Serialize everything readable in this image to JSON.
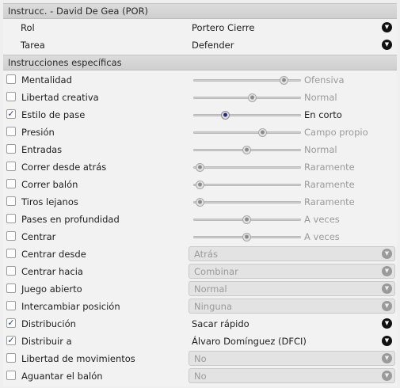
{
  "title": "Instrucc. - David De Gea (POR)",
  "role": {
    "label": "Rol",
    "value": "Portero Cierre"
  },
  "duty": {
    "label": "Tarea",
    "value": "Defender"
  },
  "specific_title": "Instrucciones específicas",
  "instructions": [
    {
      "label": "Mentalidad",
      "checked": false,
      "type": "slider",
      "level": 0.85,
      "value": "Ofensiva"
    },
    {
      "label": "Libertad creativa",
      "checked": false,
      "type": "slider",
      "level": 0.55,
      "value": "Normal"
    },
    {
      "label": "Estilo de pase",
      "checked": true,
      "type": "slider",
      "level": 0.3,
      "value": "En corto"
    },
    {
      "label": "Presión",
      "checked": false,
      "type": "slider",
      "level": 0.65,
      "value": "Campo propio"
    },
    {
      "label": "Entradas",
      "checked": false,
      "type": "slider",
      "level": 0.5,
      "value": "Normal"
    },
    {
      "label": "Correr desde atrás",
      "checked": false,
      "type": "slider",
      "level": 0.06,
      "value": "Raramente"
    },
    {
      "label": "Correr balón",
      "checked": false,
      "type": "slider",
      "level": 0.06,
      "value": "Raramente"
    },
    {
      "label": "Tiros lejanos",
      "checked": false,
      "type": "slider",
      "level": 0.06,
      "value": "Raramente"
    },
    {
      "label": "Pases en profundidad",
      "checked": false,
      "type": "slider",
      "level": 0.5,
      "value": "A veces"
    },
    {
      "label": "Centrar",
      "checked": false,
      "type": "slider",
      "level": 0.5,
      "value": "A veces"
    },
    {
      "label": "Centrar desde",
      "checked": false,
      "type": "combo",
      "value": "Atrás"
    },
    {
      "label": "Centrar hacia",
      "checked": false,
      "type": "combo",
      "value": "Combinar"
    },
    {
      "label": "Juego abierto",
      "checked": false,
      "type": "combo",
      "value": "Normal"
    },
    {
      "label": "Intercambiar posición",
      "checked": false,
      "type": "combo",
      "value": "Ninguna"
    },
    {
      "label": "Distribución",
      "checked": true,
      "type": "select",
      "value": "Sacar rápido"
    },
    {
      "label": "Distribuir a",
      "checked": true,
      "type": "select",
      "value": "Álvaro Domínguez (DFCI)"
    },
    {
      "label": "Libertad de movimientos",
      "checked": false,
      "type": "combo",
      "value": "No"
    },
    {
      "label": "Aguantar el balón",
      "checked": false,
      "type": "combo",
      "value": "No"
    }
  ],
  "icons": {
    "check": "checkmark-icon",
    "dropdown": "chevron-down-icon"
  }
}
